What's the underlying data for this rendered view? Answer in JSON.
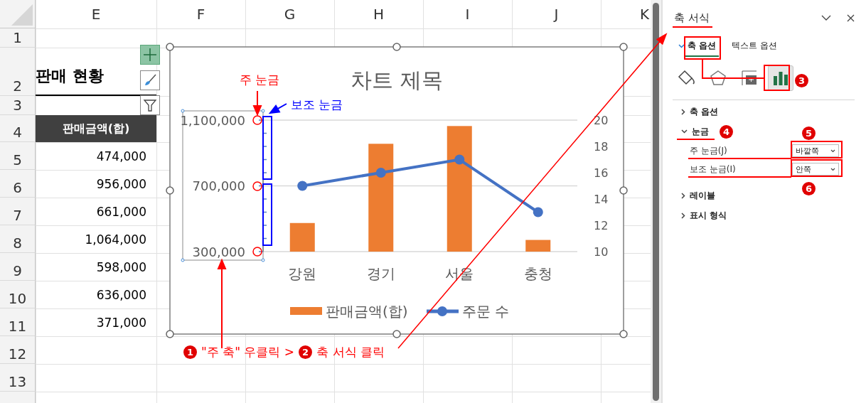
{
  "sheet": {
    "columns": [
      "E",
      "F",
      "G",
      "H",
      "I",
      "J",
      "K"
    ],
    "rows": [
      {
        "label": "1"
      },
      {
        "label": "2",
        "cell": {
          "kind": "title",
          "text": "판매 현황"
        }
      },
      {
        "label": "3"
      },
      {
        "label": "4",
        "cell": {
          "kind": "header",
          "text": "판매금액(합)"
        }
      },
      {
        "label": "5",
        "cell": {
          "kind": "number",
          "text": "474,000"
        }
      },
      {
        "label": "6",
        "cell": {
          "kind": "number",
          "text": "956,000"
        }
      },
      {
        "label": "7",
        "cell": {
          "kind": "number",
          "text": "661,000"
        }
      },
      {
        "label": "8",
        "cell": {
          "kind": "number",
          "text": "1,064,000"
        }
      },
      {
        "label": "9",
        "cell": {
          "kind": "number",
          "text": "598,000"
        }
      },
      {
        "label": "10",
        "cell": {
          "kind": "number",
          "text": "636,000"
        }
      },
      {
        "label": "11",
        "cell": {
          "kind": "number",
          "text": "371,000"
        }
      },
      {
        "label": "12"
      },
      {
        "label": "13"
      }
    ]
  },
  "chart": {
    "chart_data": {
      "type": "bar",
      "title": "차트 제목",
      "categories": [
        "강원",
        "경기",
        "서울",
        "충청"
      ],
      "series": [
        {
          "name": "판매금액(합)",
          "color": "#ed7d31",
          "values": [
            474000,
            956000,
            1064000,
            371000
          ]
        }
      ],
      "ylim": [
        300000,
        1100000
      ],
      "yticks": [
        {
          "value": 300000,
          "label": "300,000"
        },
        {
          "value": 700000,
          "label": "700,000"
        },
        {
          "value": 1100000,
          "label": "1,100,000"
        }
      ]
    },
    "secondary": {
      "chart_data": {
        "type": "line",
        "series": [
          {
            "name": "주문 수",
            "color": "#4472c4",
            "marker": true,
            "values": [
              15,
              16,
              17,
              13
            ]
          }
        ],
        "ylim": [
          10,
          20
        ],
        "yticks": [
          {
            "value": 10,
            "label": "10"
          },
          {
            "value": 12,
            "label": "12"
          },
          {
            "value": 14,
            "label": "14"
          },
          {
            "value": 16,
            "label": "16"
          },
          {
            "value": 18,
            "label": "18"
          },
          {
            "value": 20,
            "label": "20"
          }
        ]
      }
    }
  },
  "annotations": {
    "major_label": "주 눈금",
    "minor_label": "보조 눈금",
    "instruction": [
      {
        "kind": "badge",
        "text": "1"
      },
      {
        "kind": "text",
        "text": "\"주 축\" 우클릭 >"
      },
      {
        "kind": "badge",
        "text": "2"
      },
      {
        "kind": "text",
        "text": "축 서식 클릭"
      }
    ],
    "pane_badges": [
      "3",
      "4",
      "5",
      "6"
    ]
  },
  "pane": {
    "title": "축 서식",
    "tabs": [
      {
        "label": "축 옵션",
        "selected": true
      },
      {
        "label": "텍스트 옵션",
        "selected": false
      }
    ],
    "icons": [
      {
        "kind": "fill",
        "selected": false
      },
      {
        "kind": "effects",
        "selected": false
      },
      {
        "kind": "size",
        "selected": false
      },
      {
        "kind": "axis",
        "selected": true
      }
    ],
    "sections": [
      {
        "label": "축 옵션",
        "expanded": false
      },
      {
        "label": "눈금",
        "expanded": true,
        "fields": [
          {
            "label": "주 눈금(J)",
            "value": "바깥쪽"
          },
          {
            "label": "보조 눈금(I)",
            "value": "안쪽"
          }
        ]
      },
      {
        "label": "레이블",
        "expanded": false
      },
      {
        "label": "표시 형식",
        "expanded": false
      }
    ]
  }
}
